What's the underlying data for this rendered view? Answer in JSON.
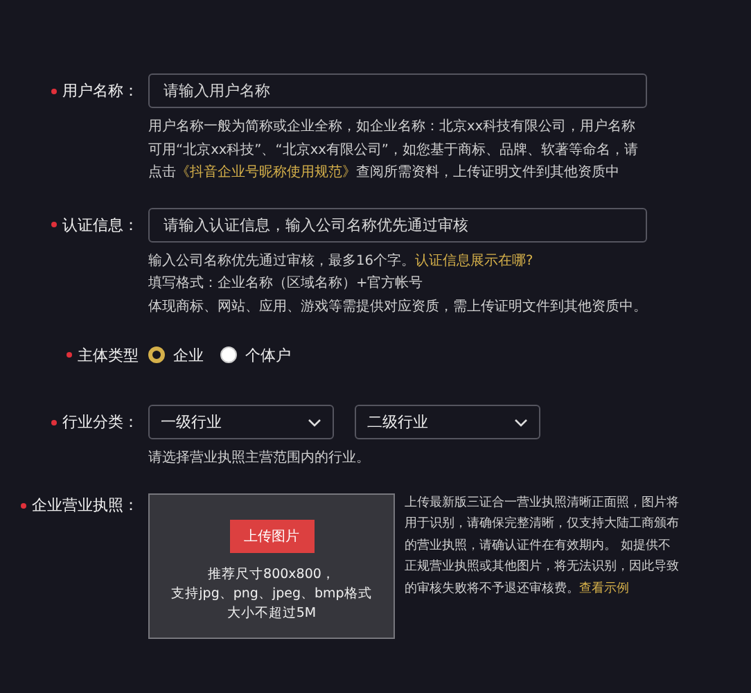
{
  "fields": [
    {
      "kind": "text",
      "label": "用户名称：",
      "required": true,
      "placeholder": "请输入用户名称",
      "help": [
        [
          {
            "kind": "text",
            "text": "用户名称一般为简称或企业全称，如企业名称：北京xx科技有限公司，用户名称可用“北京xx科技”、“北京xx有限公司”，如您基于商标、品牌、软著等命名，请点击"
          },
          {
            "kind": "link",
            "text": "《抖音企业号昵称使用规范》"
          },
          {
            "kind": "text",
            "text": "查阅所需资料，上传证明文件到其他资质中"
          }
        ]
      ]
    },
    {
      "kind": "text",
      "label": "认证信息：",
      "required": true,
      "placeholder": "请输入认证信息，输入公司名称优先通过审核",
      "help": [
        [
          {
            "kind": "text",
            "text": "输入公司名称优先通过审核，最多16个字。"
          },
          {
            "kind": "link",
            "text": "认证信息展示在哪?"
          }
        ],
        [
          {
            "kind": "text",
            "text": "填写格式：企业名称（区域名称）+官方帐号"
          }
        ],
        [
          {
            "kind": "text",
            "text": "体现商标、网站、应用、游戏等需提供对应资质，需上传证明文件到其他资质中。"
          }
        ]
      ]
    },
    {
      "kind": "radio",
      "label": "主体类型",
      "required": true,
      "options": [
        {
          "label": "企业",
          "selected": true
        },
        {
          "label": "个体户",
          "selected": false
        }
      ]
    },
    {
      "kind": "select",
      "label": "行业分类：",
      "required": true,
      "selects": [
        "一级行业",
        "二级行业"
      ],
      "help": [
        [
          {
            "kind": "text",
            "text": "请选择营业执照主营范围内的行业。"
          }
        ]
      ]
    },
    {
      "kind": "upload",
      "label": "企业营业执照：",
      "required": true,
      "button": "上传图片",
      "hints": [
        "推荐尺寸800x800，",
        "支持jpg、png、jpeg、bmp格式",
        "大小不超过5M"
      ],
      "help": [
        [
          {
            "kind": "text",
            "text": "上传最新版三证合一营业执照清晰正面照，图片将用于识别，请确保完整清晰，仅支持大陆工商颁布的营业执照，请确认证件在有效期内。 如提供不正规营业执照或其他图片，将无法识别，因此导致的审核失败将不予退还审核费。"
          },
          {
            "kind": "link",
            "text": "查看示例"
          }
        ]
      ]
    }
  ]
}
